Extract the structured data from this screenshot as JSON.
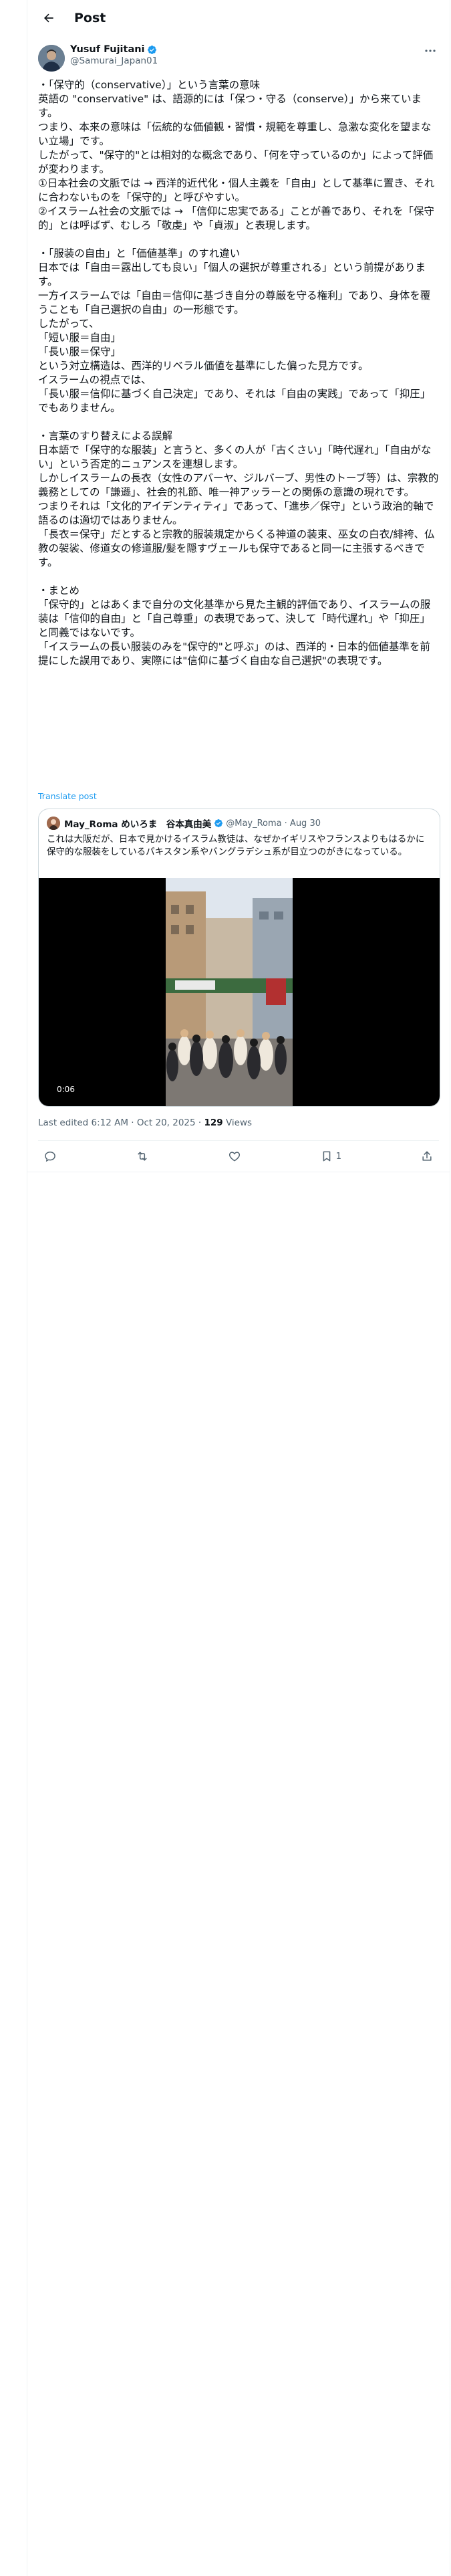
{
  "header": {
    "title": "Post"
  },
  "author": {
    "name": "Yusuf Fujitani",
    "handle": "@Samurai_Japan01"
  },
  "post_lines": [
    "・「保守的（conservative）」という言葉の意味",
    "英語の \"conservative\" は、語源的には「保つ・守る（conserve）」から来ています。",
    "つまり、本来の意味は「伝統的な価値観・習慣・規範を尊重し、急激な変化を望まない立場」です。",
    "したがって、\"保守的\"とは相対的な概念であり、「何を守っているのか」によって評価が変わります。",
    "①日本社会の文脈では → 西洋的近代化・個人主義を「自由」として基準に置き、それに合わないものを「保守的」と呼びやすい。",
    "②イスラーム社会の文脈では → 「信仰に忠実である」ことが善であり、それを「保守的」とは呼ばず、むしろ「敬虔」や「貞淑」と表現します。",
    "",
    "・「服装の自由」と「価値基準」のすれ違い",
    "日本では「自由＝露出しても良い」「個人の選択が尊重される」という前提があります。",
    "一方イスラームでは「自由＝信仰に基づき自分の尊厳を守る権利」であり、身体を覆うことも「自己選択の自由」の一形態です。",
    "したがって、",
    "「短い服＝自由」",
    "「長い服＝保守」",
    "という対立構造は、西洋的リベラル価値を基準にした偏った見方です。",
    "イスラームの視点では、",
    "「長い服＝信仰に基づく自己決定」であり、それは「自由の実践」であって「抑圧」でもありません。",
    "",
    "・言葉のすり替えによる誤解",
    "日本語で「保守的な服装」と言うと、多くの人が「古くさい」「時代遅れ」「自由がない」という否定的ニュアンスを連想します。",
    "しかしイスラームの長衣（女性のアバーヤ、ジルバーブ、男性のトーブ等）は、宗教的義務としての「謙遜」、社会的礼節、唯一神アッラーとの関係の意識の現れです。",
    "つまりそれは「文化的アイデンティティ」であって、「進歩／保守」という政治的軸で語るのは適切ではありません。",
    "「長衣＝保守」だとすると宗教的服装規定からくる神道の装束、巫女の白衣/緋袴、仏教の袈裟、修道女の修道服/髪を隠すヴェールも保守であると同一に主張するべきです。",
    "",
    "・まとめ",
    "「保守的」とはあくまで自分の文化基準から見た主観的評価であり、イスラームの服装は「信仰的自由」と「自己尊重」の表現であって、決して「時代遅れ」や「抑圧」と同義ではないです。",
    "「イスラームの長い服装のみを\"保守的\"と呼ぶ」のは、西洋的・日本的価値基準を前提にした誤用であり、実際には\"信仰に基づく自由な自己選択\"の表現です。"
  ],
  "translate_label": "Translate post",
  "quote": {
    "name": "May_Roma めいろま　谷本真由美",
    "handle": "@May_Roma",
    "date": "· Aug 30",
    "text": "これは大阪だが、日本で見かけるイスラム教徒は、なぜかイギリスやフランスよりもはるかに保守的な服装をしているパキスタン系やバングラデシュ系が目立つのがきになっている。",
    "video_time": "0:06"
  },
  "meta": {
    "edited": "Last edited 6:12 AM · Oct 20, 2025 · ",
    "views_count": "129",
    "views_label": " Views"
  },
  "actions": {
    "bookmarks": "1"
  },
  "colors": {
    "accent": "#1d9bf0",
    "text": "#0f1419",
    "secondary": "#536471",
    "border": "#eff3f4"
  }
}
